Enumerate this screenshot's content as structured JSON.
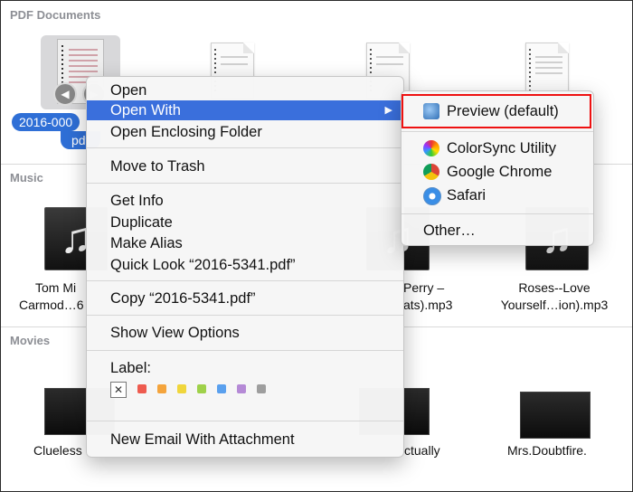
{
  "sections": {
    "pdf": "PDF Documents",
    "music": "Music",
    "movies": "Movies"
  },
  "pdf": {
    "selected_name_line1": "2016-000",
    "selected_name_line2": "pdf"
  },
  "music": {
    "items": [
      {
        "line1": "Tom Mi",
        "line2": "Carmod…6"
      },
      {
        "line1": "Perry –",
        "line2": "ats).mp3"
      },
      {
        "line1": "Roses--Love",
        "line2": "Yourself…ion).mp3"
      }
    ]
  },
  "movies": {
    "items": [
      "Clueless",
      "ctually",
      "Mrs.Doubtfire."
    ]
  },
  "context_menu": {
    "open": "Open",
    "open_with": "Open With",
    "open_enclosing_folder": "Open Enclosing Folder",
    "move_to_trash": "Move to Trash",
    "get_info": "Get Info",
    "duplicate": "Duplicate",
    "make_alias": "Make Alias",
    "quick_look": "Quick Look “2016-5341.pdf”",
    "copy": "Copy “2016-5341.pdf”",
    "show_view_options": "Show View Options",
    "label": "Label:",
    "label_colors": [
      "#ee5b4f",
      "#f4a43c",
      "#f0d63c",
      "#9fd14a",
      "#5aa0ee",
      "#b58ad6",
      "#9e9e9e"
    ],
    "new_email": "New Email With Attachment"
  },
  "submenu": {
    "preview": "Preview (default)",
    "colorsync": "ColorSync Utility",
    "chrome": "Google Chrome",
    "safari": "Safari",
    "other": "Other…"
  }
}
